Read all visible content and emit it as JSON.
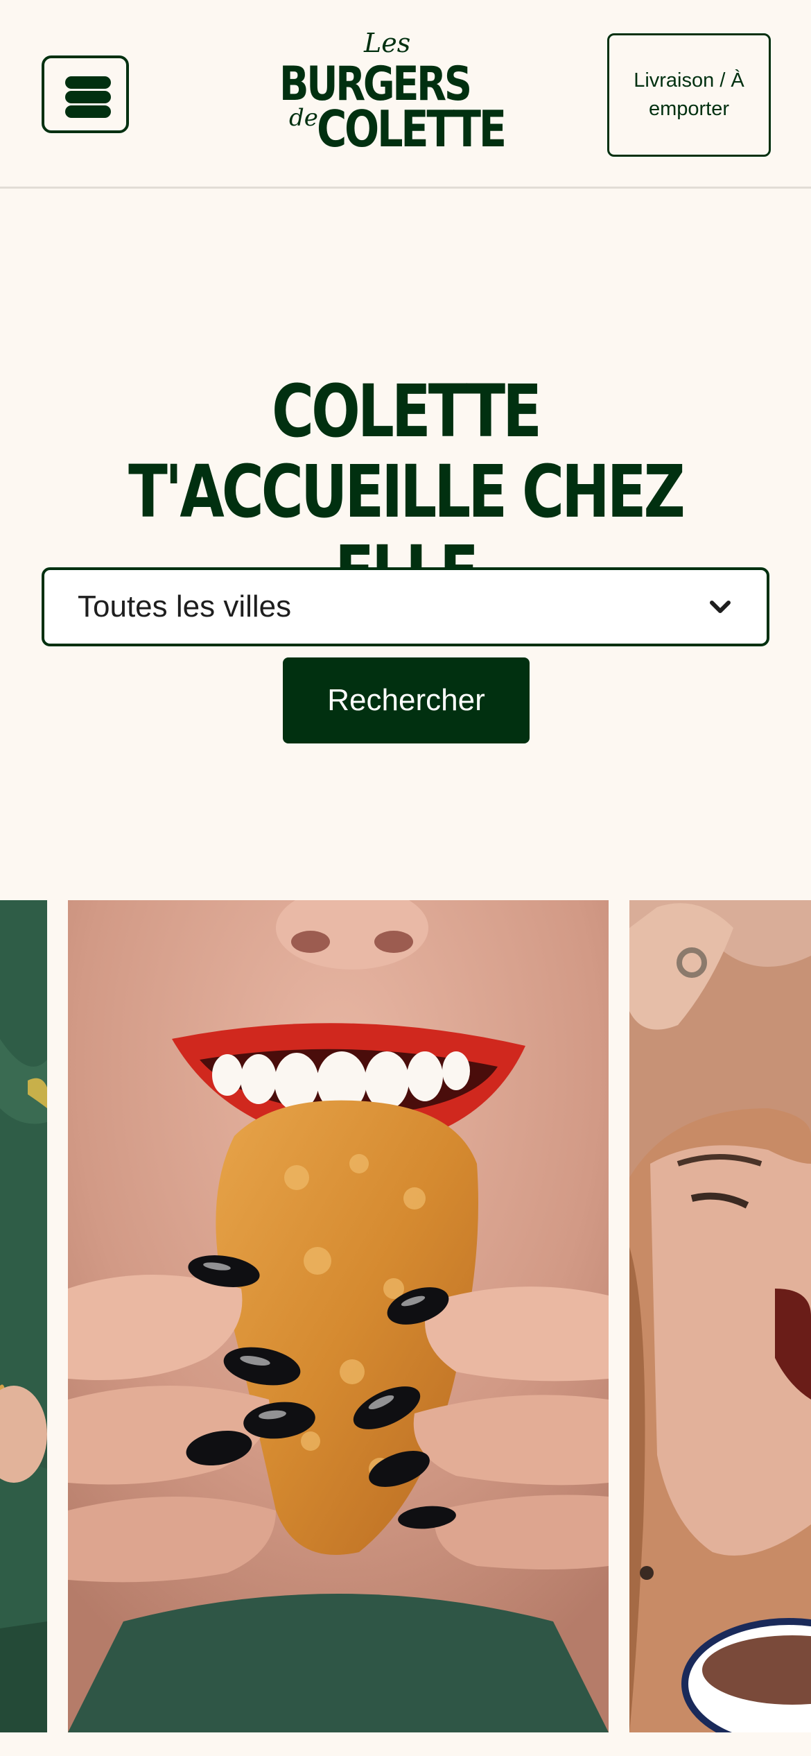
{
  "header": {
    "menu_icon": "hamburger-menu-icon",
    "logo": {
      "les": "Les",
      "burgers": "BURGERS",
      "de": "de",
      "colette": "COLETTE"
    },
    "delivery_button": "Livraison / À emporter"
  },
  "hero": {
    "title": "COLETTE T'ACCUEILLE CHEZ ELLE",
    "city_select": {
      "selected": "Toutes les villes",
      "icon": "chevron-down-icon"
    },
    "search_button": "Rechercher"
  },
  "carousel": {
    "slides": [
      {
        "subject": "person in green shirt"
      },
      {
        "subject": "woman biting fried chicken tender"
      },
      {
        "subject": "laughing woman holding bowl"
      }
    ]
  },
  "colors": {
    "brand_green": "#013010",
    "background": "#fdf8f2"
  }
}
